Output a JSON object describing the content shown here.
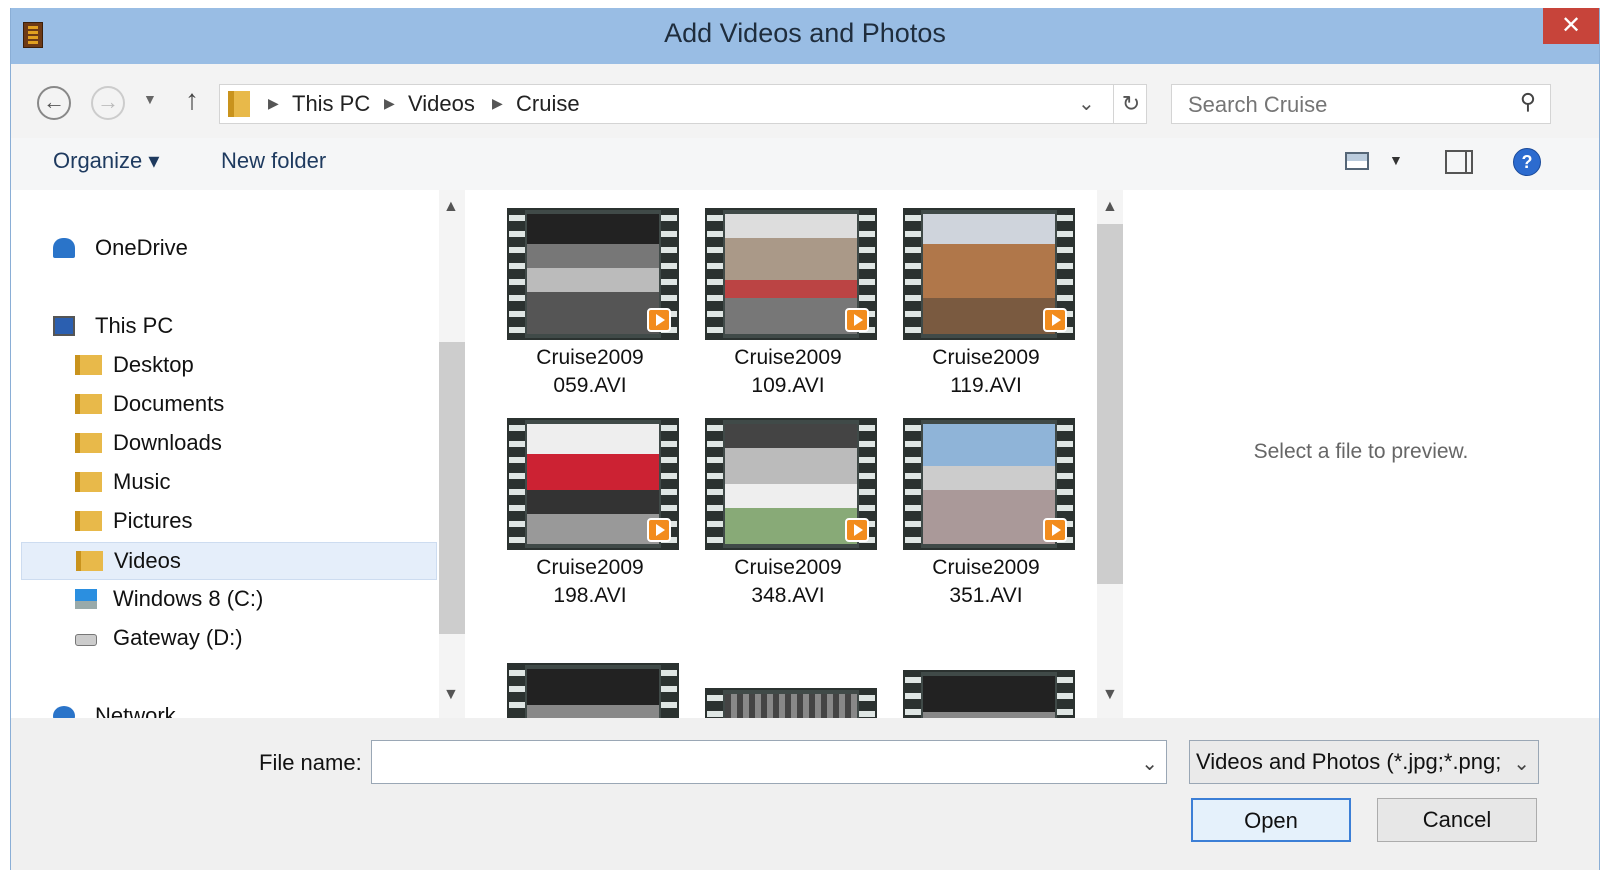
{
  "window": {
    "title": "Add Videos and Photos",
    "close_glyph": "✕",
    "app_icon": "film-strip-icon"
  },
  "address_bar": {
    "crumbs": [
      "This PC",
      "Videos",
      "Cruise"
    ],
    "search_placeholder": "Search Cruise"
  },
  "toolbar": {
    "organize_label": "Organize ▾",
    "new_folder_label": "New folder"
  },
  "nav_pane": {
    "items": [
      {
        "label": "OneDrive",
        "icon": "onedrive-icon"
      },
      {
        "label": "This PC",
        "icon": "computer-icon"
      },
      {
        "label": "Desktop",
        "icon": "desktop-folder-icon"
      },
      {
        "label": "Documents",
        "icon": "documents-folder-icon"
      },
      {
        "label": "Downloads",
        "icon": "downloads-folder-icon"
      },
      {
        "label": "Music",
        "icon": "music-folder-icon"
      },
      {
        "label": "Pictures",
        "icon": "pictures-folder-icon"
      },
      {
        "label": "Videos",
        "icon": "videos-folder-icon",
        "selected": true
      },
      {
        "label": "Windows 8 (C:)",
        "icon": "windows-drive-icon"
      },
      {
        "label": "Gateway (D:)",
        "icon": "drive-icon"
      },
      {
        "label": "Network",
        "icon": "network-icon"
      }
    ]
  },
  "files": [
    {
      "line1": "Cruise2009",
      "line2": "059.AVI"
    },
    {
      "line1": "Cruise2009",
      "line2": "109.AVI"
    },
    {
      "line1": "Cruise2009",
      "line2": "119.AVI"
    },
    {
      "line1": "Cruise2009",
      "line2": "198.AVI"
    },
    {
      "line1": "Cruise2009",
      "line2": "348.AVI"
    },
    {
      "line1": "Cruise2009",
      "line2": "351.AVI"
    }
  ],
  "preview": {
    "message": "Select a file to preview."
  },
  "footer": {
    "file_name_label": "File name:",
    "file_name_value": "",
    "filter_value": "Videos and Photos (*.jpg;*.png;",
    "open_label": "Open",
    "cancel_label": "Cancel"
  }
}
